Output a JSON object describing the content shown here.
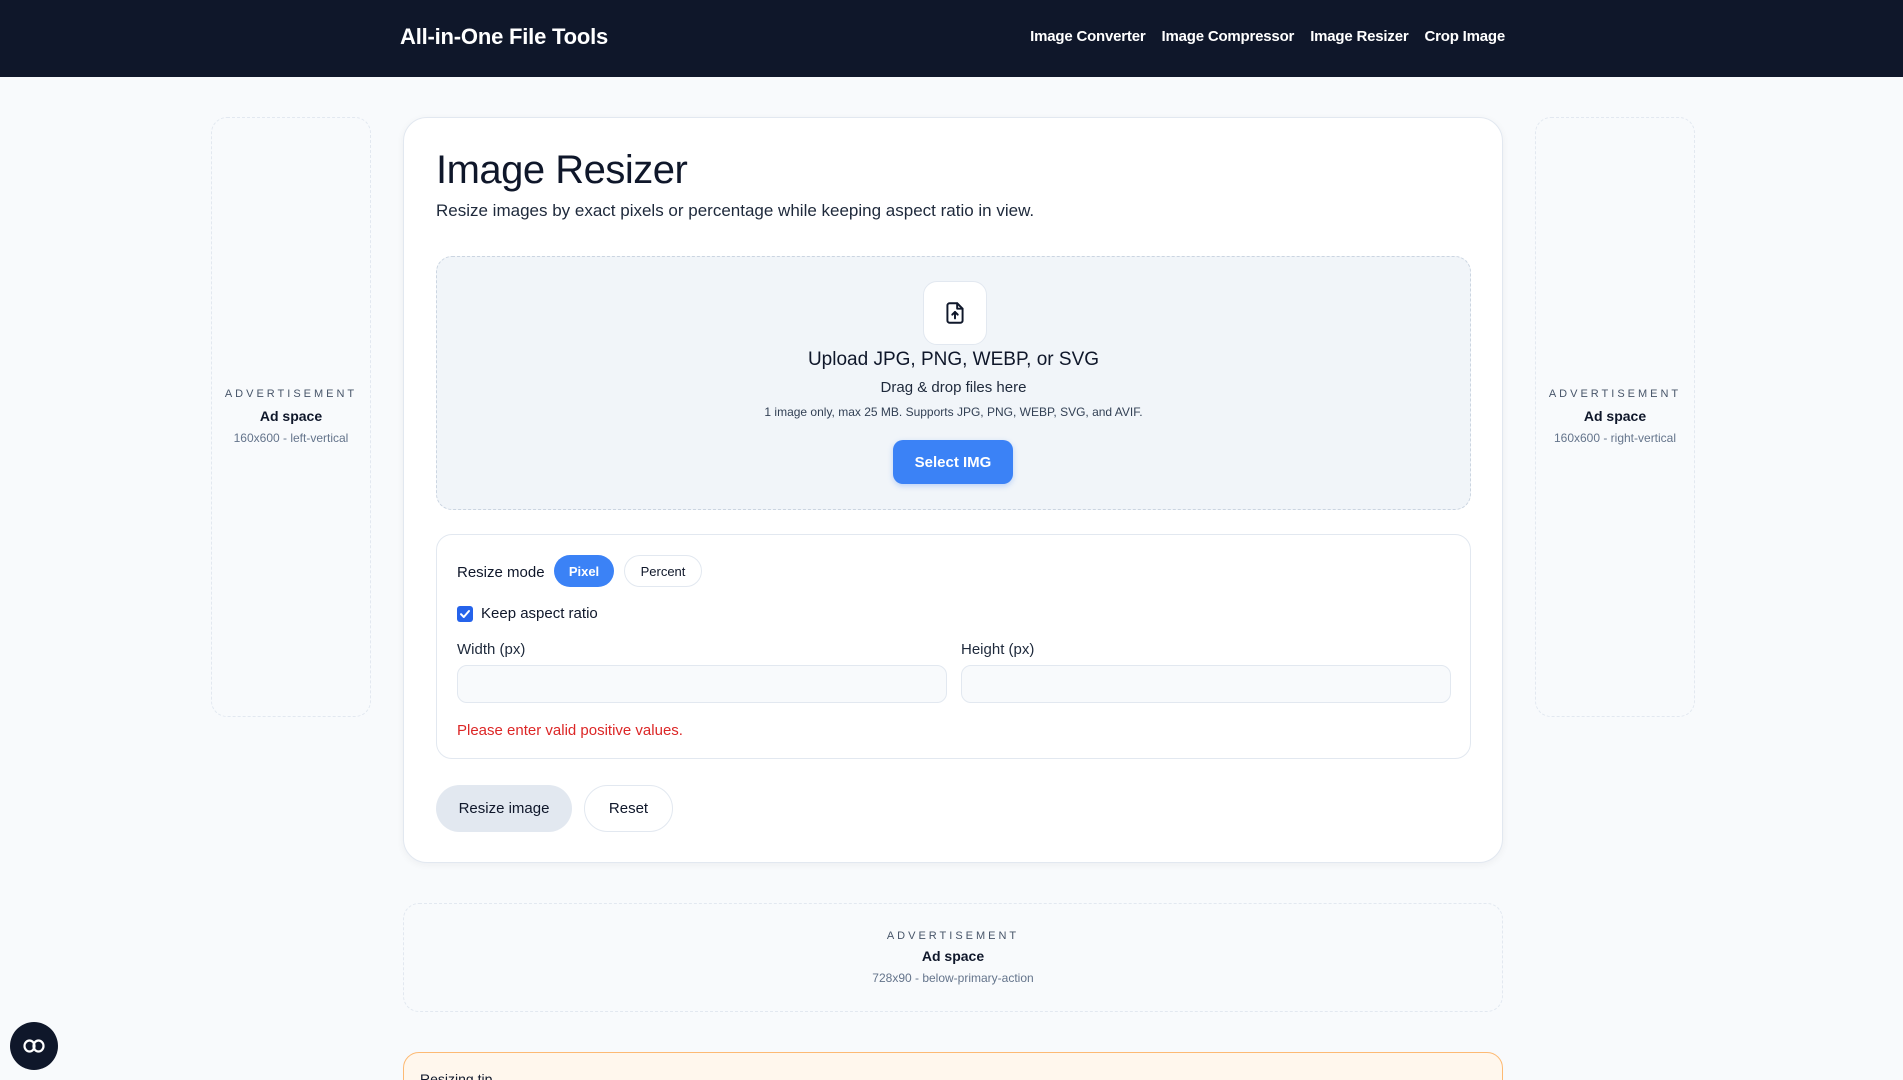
{
  "header": {
    "brand": "All-in-One File Tools",
    "nav": [
      "Image Converter",
      "Image Compressor",
      "Image Resizer",
      "Crop Image"
    ]
  },
  "ads": {
    "left": {
      "label": "ADVERTISEMENT",
      "title": "Ad space",
      "size": "160x600 - left-vertical"
    },
    "right": {
      "label": "ADVERTISEMENT",
      "title": "Ad space",
      "size": "160x600 - right-vertical"
    },
    "banner": {
      "label": "ADVERTISEMENT",
      "title": "Ad space",
      "size": "728x90 - below-primary-action"
    }
  },
  "main": {
    "title": "Image Resizer",
    "subtitle": "Resize images by exact pixels or percentage while keeping aspect ratio in view.",
    "dropzone": {
      "icon": "file-upload-icon",
      "title": "Upload JPG, PNG, WEBP, or SVG",
      "subtitle": "Drag & drop files here",
      "note": "1 image only, max 25 MB. Supports JPG, PNG, WEBP, SVG, and AVIF.",
      "button": "Select IMG"
    },
    "options": {
      "mode_label": "Resize mode",
      "modes": [
        "Pixel",
        "Percent"
      ],
      "selected_mode": "Pixel",
      "keep_aspect_label": "Keep aspect ratio",
      "keep_aspect_checked": true,
      "width_label": "Width (px)",
      "width_value": "",
      "height_label": "Height (px)",
      "height_value": "",
      "error": "Please enter valid positive values."
    },
    "actions": {
      "resize": "Resize image",
      "reset": "Reset"
    }
  },
  "tip": {
    "title": "Resizing tip"
  },
  "colors": {
    "accent": "#3b82f6",
    "header_bg": "#0f172a",
    "error": "#dc2626",
    "tip_bg": "#fff7ed",
    "tip_border": "#fdba74"
  },
  "floating_button": {
    "icon": "link-icon"
  }
}
